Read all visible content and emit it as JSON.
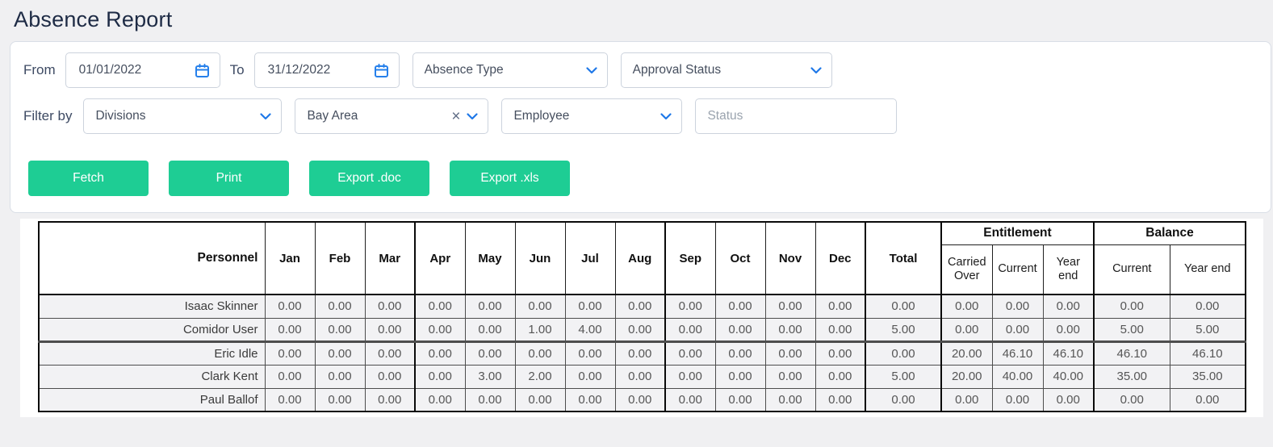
{
  "page": {
    "title": "Absence Report"
  },
  "colors": {
    "accent_blue": "#2680eb",
    "button_green": "#1ecd94",
    "title_navy": "#1e2b45",
    "row_gray": "#f2f2f4"
  },
  "filters": {
    "from_label": "From",
    "from_value": "01/01/2022",
    "to_label": "To",
    "to_value": "31/12/2022",
    "absence_type_label": "Absence Type",
    "approval_status_label": "Approval Status",
    "filter_by_label": "Filter by",
    "divisions_label": "Divisions",
    "division_selected": "Bay Area",
    "employee_label": "Employee",
    "status_placeholder": "Status"
  },
  "actions": {
    "fetch": "Fetch",
    "print": "Print",
    "export_doc": "Export .doc",
    "export_xls": "Export .xls"
  },
  "table": {
    "columns": {
      "personnel": "Personnel",
      "months": [
        "Jan",
        "Feb",
        "Mar",
        "Apr",
        "May",
        "Jun",
        "Jul",
        "Aug",
        "Sep",
        "Oct",
        "Nov",
        "Dec"
      ],
      "total": "Total",
      "entitlement_group": "Entitlement",
      "balance_group": "Balance",
      "entitlement_sub": [
        "Carried Over",
        "Current",
        "Year end"
      ],
      "balance_sub": [
        "Current",
        "Year end"
      ]
    },
    "rows": [
      {
        "personnel": "Isaac Skinner",
        "months": [
          "0.00",
          "0.00",
          "0.00",
          "0.00",
          "0.00",
          "0.00",
          "0.00",
          "0.00",
          "0.00",
          "0.00",
          "0.00",
          "0.00"
        ],
        "total": "0.00",
        "entitlement": [
          "0.00",
          "0.00",
          "0.00"
        ],
        "balance": [
          "0.00",
          "0.00"
        ]
      },
      {
        "personnel": "Comidor User",
        "months": [
          "0.00",
          "0.00",
          "0.00",
          "0.00",
          "0.00",
          "1.00",
          "4.00",
          "0.00",
          "0.00",
          "0.00",
          "0.00",
          "0.00"
        ],
        "total": "5.00",
        "entitlement": [
          "0.00",
          "0.00",
          "0.00"
        ],
        "balance": [
          "5.00",
          "5.00"
        ]
      },
      {
        "personnel": "Eric Idle",
        "months": [
          "0.00",
          "0.00",
          "0.00",
          "0.00",
          "0.00",
          "0.00",
          "0.00",
          "0.00",
          "0.00",
          "0.00",
          "0.00",
          "0.00"
        ],
        "total": "0.00",
        "entitlement": [
          "20.00",
          "46.10",
          "46.10"
        ],
        "balance": [
          "46.10",
          "46.10"
        ]
      },
      {
        "personnel": "Clark Kent",
        "months": [
          "0.00",
          "0.00",
          "0.00",
          "0.00",
          "3.00",
          "2.00",
          "0.00",
          "0.00",
          "0.00",
          "0.00",
          "0.00",
          "0.00"
        ],
        "total": "5.00",
        "entitlement": [
          "20.00",
          "40.00",
          "40.00"
        ],
        "balance": [
          "35.00",
          "35.00"
        ]
      },
      {
        "personnel": "Paul Ballof",
        "months": [
          "0.00",
          "0.00",
          "0.00",
          "0.00",
          "0.00",
          "0.00",
          "0.00",
          "0.00",
          "0.00",
          "0.00",
          "0.00",
          "0.00"
        ],
        "total": "0.00",
        "entitlement": [
          "0.00",
          "0.00",
          "0.00"
        ],
        "balance": [
          "0.00",
          "0.00"
        ]
      }
    ]
  }
}
